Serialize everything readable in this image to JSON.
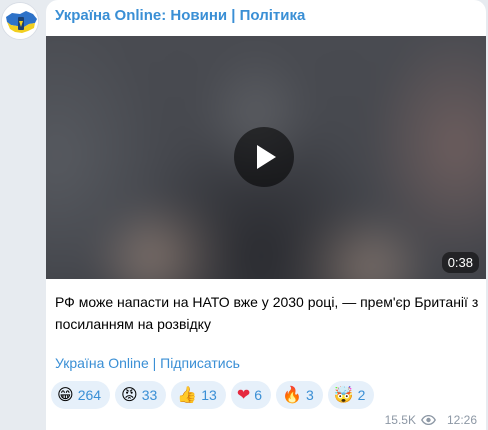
{
  "channel": {
    "title": "Україна Online: Новини | Політика"
  },
  "video": {
    "duration": "0:38"
  },
  "post": {
    "text": "РФ може напасти на НАТО вже у 2030 році, — прем'єр Британії з посиланням на розвідку",
    "footer_channel": "Україна Online",
    "footer_separator": " | ",
    "footer_subscribe": "Підписатись"
  },
  "reactions": [
    {
      "emoji": "😁",
      "icon": "grinning-face-icon",
      "count": "264"
    },
    {
      "emoji": "😡",
      "icon": "angry-face-icon",
      "count": "33"
    },
    {
      "emoji": "👍",
      "icon": "thumbs-up-icon",
      "count": "13"
    },
    {
      "emoji": "❤",
      "icon": "heart-icon",
      "count": "6"
    },
    {
      "emoji": "🔥",
      "icon": "fire-icon",
      "count": "3"
    },
    {
      "emoji": "🤯",
      "icon": "exploding-head-icon",
      "count": "2"
    }
  ],
  "meta": {
    "views": "15.5K",
    "time": "12:26"
  },
  "colors": {
    "accent": "#3a8fd5",
    "reaction_bg": "#e6f0fa",
    "meta_text": "#8d98a5",
    "page_bg": "#e7ebf0"
  }
}
